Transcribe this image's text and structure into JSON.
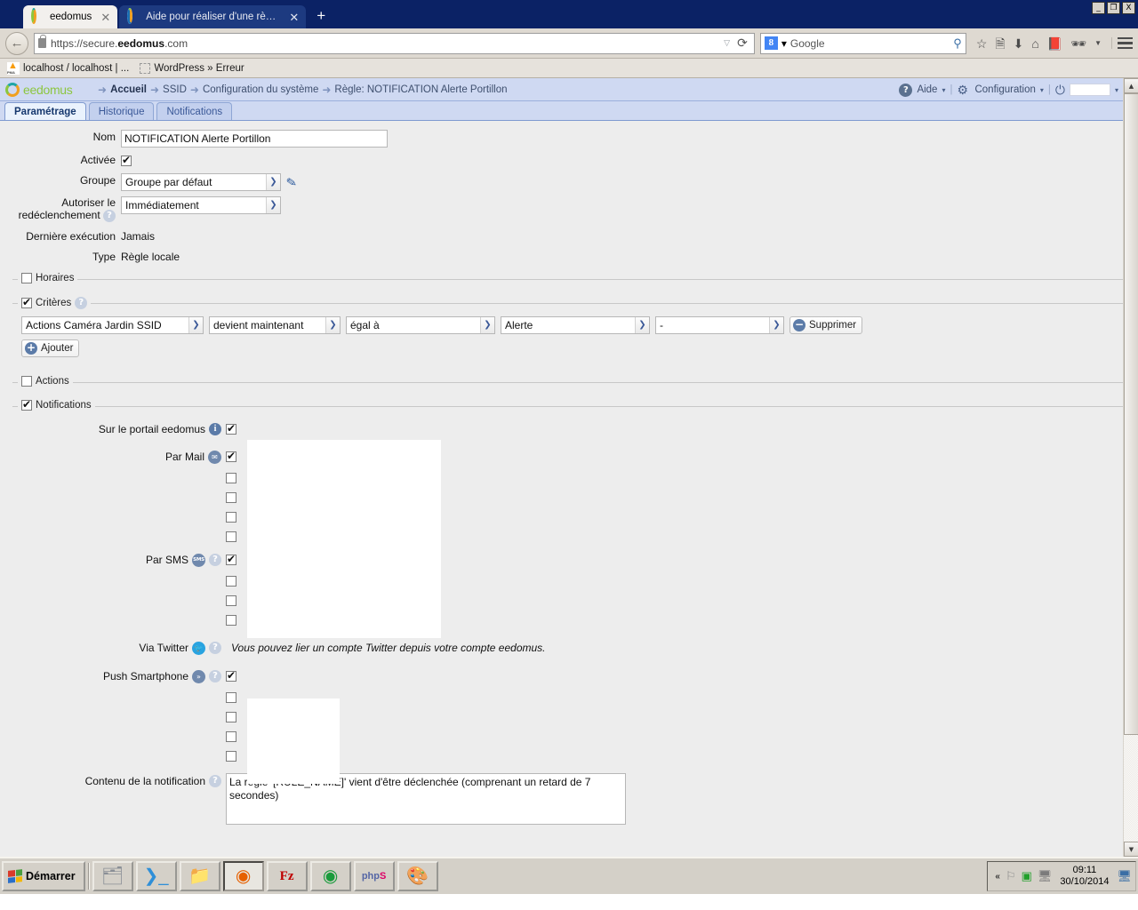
{
  "browser": {
    "tabs": [
      {
        "title": "eedomus",
        "active": true,
        "favicon": "eedomus-ring-icon",
        "close": "✕"
      },
      {
        "title": "Aide pour réaliser d'une règle ...",
        "active": false,
        "favicon": "eedomus-ring-icon",
        "close": "✕"
      }
    ],
    "new_tab_label": "+",
    "window_controls": {
      "minimize": "_",
      "maximize": "❐",
      "close": "X"
    },
    "back_arrow": "←",
    "url_prefix": "https://secure.",
    "url_bold": "eedomus",
    "url_suffix": ".com",
    "url_dropdown": "▽",
    "reload": "⟳",
    "search_engine": "Google",
    "search_engine_letter": "8",
    "search_dropdown": "▾",
    "toolbar_icons": [
      "star-icon",
      "reading-list-icon",
      "download-icon",
      "home-icon",
      "pocket-icon",
      "noscript-icon",
      "overflow-icon"
    ],
    "bookmarks": [
      {
        "label": "localhost / localhost | ...",
        "icon": "phpmyadmin-icon"
      },
      {
        "label": "WordPress » Erreur",
        "icon": "blank-favicon"
      }
    ]
  },
  "app": {
    "brand": "eedomus",
    "breadcrumbs": [
      "Accueil",
      "SSID",
      "Configuration du système",
      "Règle: NOTIFICATION Alerte Portillon"
    ],
    "header_right": {
      "help_label": "Aide",
      "config_label": "Configuration",
      "caret": "▾",
      "user_value": ""
    },
    "tabs": [
      {
        "label": "Paramétrage",
        "active": true
      },
      {
        "label": "Historique",
        "active": false
      },
      {
        "label": "Notifications",
        "active": false
      }
    ]
  },
  "form": {
    "nom_label": "Nom",
    "nom_value": "NOTIFICATION Alerte Portillon",
    "activee_label": "Activée",
    "activee_checked": true,
    "groupe_label": "Groupe",
    "groupe_value": "Groupe par défaut",
    "autoriser_label": "Autoriser le redéclenchement",
    "autoriser_value": "Immédiatement",
    "derniere_label": "Dernière exécution",
    "derniere_value": "Jamais",
    "type_label": "Type",
    "type_value": "Règle locale"
  },
  "sections": {
    "horaires": {
      "label": "Horaires",
      "checked": false
    },
    "criteres": {
      "label": "Critères",
      "checked": true,
      "row": {
        "device": "Actions Caméra Jardin SSID",
        "trigger": "devient maintenant",
        "operator": "égal à",
        "value": "Alerte",
        "extra": "-"
      },
      "delete_label": "Supprimer",
      "add_label": "Ajouter"
    },
    "actions": {
      "label": "Actions",
      "checked": false
    },
    "notifications": {
      "label": "Notifications",
      "checked": true,
      "portail": {
        "label": "Sur le portail eedomus",
        "checked": true
      },
      "mail": {
        "label": "Par Mail",
        "checked": true,
        "extra_rows": 4
      },
      "sms": {
        "label": "Par SMS",
        "checked": true,
        "extra_rows": 3
      },
      "twitter": {
        "label": "Via Twitter",
        "note": "Vous pouvez lier un compte Twitter depuis votre compte eedomus."
      },
      "push": {
        "label": "Push Smartphone",
        "checked": true,
        "extra_rows": 4
      },
      "contenu": {
        "label": "Contenu de la notification",
        "value": "La règle '[RULE_NAME]' vient d'être déclenchée (comprenant un retard de 7 secondes)"
      }
    }
  },
  "taskbar": {
    "start_label": "Démarrer",
    "buttons": [
      {
        "name": "server-manager-icon",
        "glyph": "🖧",
        "active": false
      },
      {
        "name": "powershell-icon",
        "glyph": "❯",
        "active": false
      },
      {
        "name": "file-explorer-icon",
        "glyph": "🗂",
        "active": false
      },
      {
        "name": "firefox-icon",
        "glyph": "🦊",
        "active": true
      },
      {
        "name": "filezilla-icon",
        "glyph": "Fz",
        "active": false
      },
      {
        "name": "chrome-icon",
        "glyph": "◉",
        "active": false
      },
      {
        "name": "phpstorm-icon",
        "glyph": "phpS",
        "active": false
      },
      {
        "name": "paint-icon",
        "glyph": "🎨",
        "active": false
      }
    ],
    "tray": {
      "chevron": "«",
      "icons": [
        "flag-icon",
        "notepad-icon",
        "network-icon"
      ],
      "time": "09:11",
      "date": "30/10/2014",
      "show-desktop-icon": "desktop-icon"
    }
  }
}
